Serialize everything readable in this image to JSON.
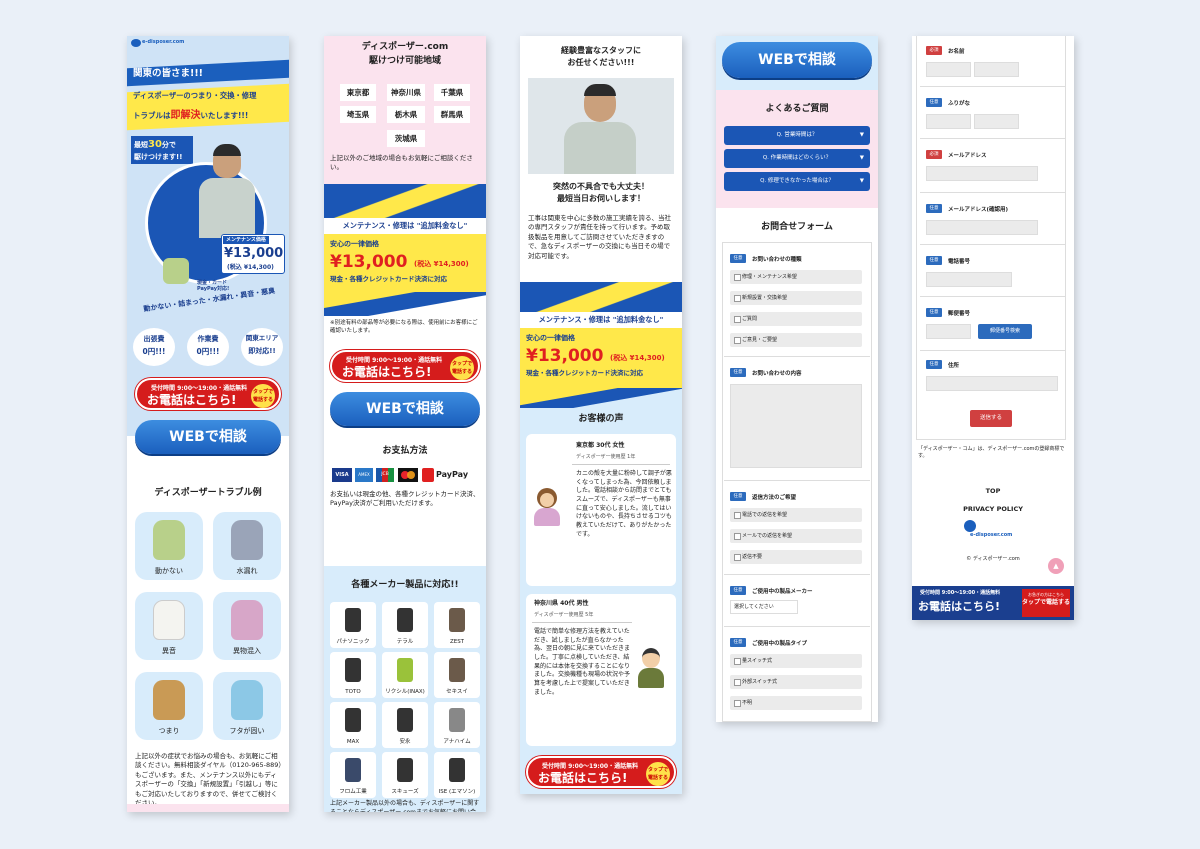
{
  "col1": {
    "logo": "e-disposer.com",
    "hero_a": "関東の皆さま!!!",
    "hero_b": "ディスポーザーのつまり・交換・修理",
    "hero_c": "トラブルは",
    "hero_d": "即解決",
    "hero_e": "いたします!!!",
    "fast_a": "最短",
    "fast_b": "30",
    "fast_c": "分で",
    "fast_d": "駆けつけます!!",
    "maint_label": "メンテナンス価格",
    "maint_price": "¥13,000",
    "maint_tax": "(税込 ¥14,300)",
    "pay_note": "現金・カード PayPay対応!",
    "arc_text": "動かない・詰まった・水漏れ・異音・悪臭",
    "badges": [
      [
        "出張費",
        "0円!!!"
      ],
      [
        "作業費",
        "0円!!!"
      ],
      [
        "関東エリア",
        "即対応!!"
      ]
    ],
    "call": {
      "hours": "受付時間 9:00～19:00・通話無料",
      "main": "お電話はこちら!",
      "tap": "タップで電話する"
    },
    "web_button": "WEBで相談",
    "trouble_title": "ディスポーザートラブル例",
    "troubles": [
      "動かない",
      "水漏れ",
      "異音",
      "異物混入",
      "つまり",
      "フタが固い"
    ],
    "body_text": "上記以外の症状でお悩みの場合も、お気軽にご相談ください。無料相談ダイヤル（0120-965-889）もございます。また、メンテナンス以外にもディスポーザーの「交換」「新規設置」「引越し」等にもご対応いたしておりますので、併せてご検討ください。"
  },
  "col2": {
    "title1": "ディスポーザー.com",
    "title2": "駆けつけ可能地域",
    "prefs": [
      "東京都",
      "神奈川県",
      "千葉県",
      "埼玉県",
      "栃木県",
      "群馬県",
      "茨城県"
    ],
    "area_note": "上記以外のご地域の場合もお気軽にご相談ください。",
    "maint_band": "メンテナンス・修理は \"追加料金なし\"",
    "flat_label": "安心の一律価格",
    "price": "¥13,000",
    "tax": "(税込 ¥14,300)",
    "cards": "現金・各種クレジットカード決済に対応",
    "part_note": "※別途有料の部品等が必要になる際は、使用前にお客様にご確認いたします。",
    "call": {
      "hours": "受付時間 9:00～19:00・通話無料",
      "main": "お電話はこちら!",
      "tap": "タップで電話する"
    },
    "web_button": "WEBで相談",
    "pay_title": "お支払方法",
    "pay_icons": [
      "VISA",
      "AMEX",
      "JCB",
      "MC",
      "PayPay"
    ],
    "pay_text": "お支払いは現金の他、各種クレジットカード決済、PayPay決済がご利用いただけます。",
    "maker_title": "各種メーカー製品に対応!!",
    "makers": [
      "パナソニック",
      "テラル",
      "ZEST",
      "TOTO",
      "リクシル(INAX)",
      "セキスイ",
      "MAX",
      "安永",
      "アナハイム",
      "フロム工業",
      "スキューズ",
      "ISE (エマソン)"
    ],
    "maker_text": "上記メーカー製品以外の場合も、ディスポーザーに関することならディスポーザー.comまでお気軽にお問い合わせください。"
  },
  "col3": {
    "staff_a": "経験豊富なスタッフに",
    "staff_b": "お任せください!!!",
    "sudden_a": "突然の不具合でも大丈夫！",
    "sudden_b": "最短当日お伺いします！",
    "body": "工事は関東を中心に多数の施工実績を誇る、当社の専門スタッフが責任を持って行います。予め取扱製品を用意してご訪問させていただきますので、急なディスポーザーの交換にも当日その場で対応可能です。",
    "maint_band": "メンテナンス・修理は \"追加料金なし\"",
    "flat_label": "安心の一律価格",
    "price": "¥13,000",
    "tax": "(税込 ¥14,300)",
    "cards": "現金・各種クレジットカード決済に対応",
    "voice_title": "お客様の声",
    "v1_name": "東京都 30代 女性",
    "v1_sub": "ディスポーザー使用歴 1年",
    "v1_text": "カニの殻を大量に粉砕して調子が悪くなってしまった為、今回依頼しました。電話相談から訪問までとてもスムーズで、ディスポーザーも無事に直って安心しました。流してはいけないものや、長持ちさせるコツも教えていただけて、ありがたかったです。",
    "v2_name": "神奈川県 40代 男性",
    "v2_sub": "ディスポーザー使用歴 5年",
    "v2_text": "電話で簡単な修理方法を教えていただき、試しましたが直らなかった為、翌日の朝に見に来ていただきました。丁寧に点検していただき、結果的には本体を交換することになりました。交換機種も現場の状況や予算を考慮した上で提案していただきました。",
    "call": {
      "hours": "受付時間 9:00～19:00・通話無料",
      "main": "お電話はこちら!",
      "tap": "タップで電話する"
    }
  },
  "col4": {
    "web_button": "WEBで相談",
    "faq_title": "よくあるご質問",
    "faqs": [
      "Q. 営業時間は？",
      "Q. 作業時間はどのくらい？",
      "Q. 修理できなかった場合は？"
    ],
    "form_title": "お問合せフォーム",
    "tag_nin": "任意",
    "q1": "お問い合わせの種類",
    "q1_opts": [
      "修理・メンテナンス希望",
      "新規設置・交換希望",
      "ご質問",
      "ご意見・ご要望"
    ],
    "q2": "お問い合わせの内容",
    "q3": "返信方法のご希望",
    "q3_opts": [
      "電話での返信を希望",
      "メールでの返信を希望",
      "返信不要"
    ],
    "q4": "ご使用中の製品メーカー",
    "q4_select": "選択してください",
    "q5": "ご使用中の製品タイプ",
    "q5_opts": [
      "量スイッチ式",
      "外部スイッチ式",
      "不明"
    ]
  },
  "col5": {
    "tag_req": "必須",
    "tag_nin": "任意",
    "f_name": "お名前",
    "f_kana": "ふりがな",
    "f_mail": "メールアドレス",
    "f_mail2": "メールアドレス(確認用)",
    "f_tel": "電話番号",
    "f_zip": "郵便番号",
    "zip_button": "郵便番号検索",
    "f_addr": "住所",
    "submit": "送信する",
    "trademark": "「ディスポーザー・コム」は、ディスポーザー.comの登録商標です。",
    "top": "TOP",
    "privacy": "PRIVACY POLICY",
    "logo": "e-disposer.com",
    "copy": "© ディスポーザー.com",
    "call": {
      "hours": "受付時間 9:00～19:00・通話無料",
      "main": "お電話はこちら!",
      "side": "お急ぎの方はこちら",
      "tap": "タップで電話する"
    }
  },
  "colors": {
    "blue": "#1b5fbd",
    "yellow": "#ffe84a",
    "red": "#d51c1c",
    "pink": "#fbe3ee",
    "lightblue": "#d8ecfb"
  }
}
